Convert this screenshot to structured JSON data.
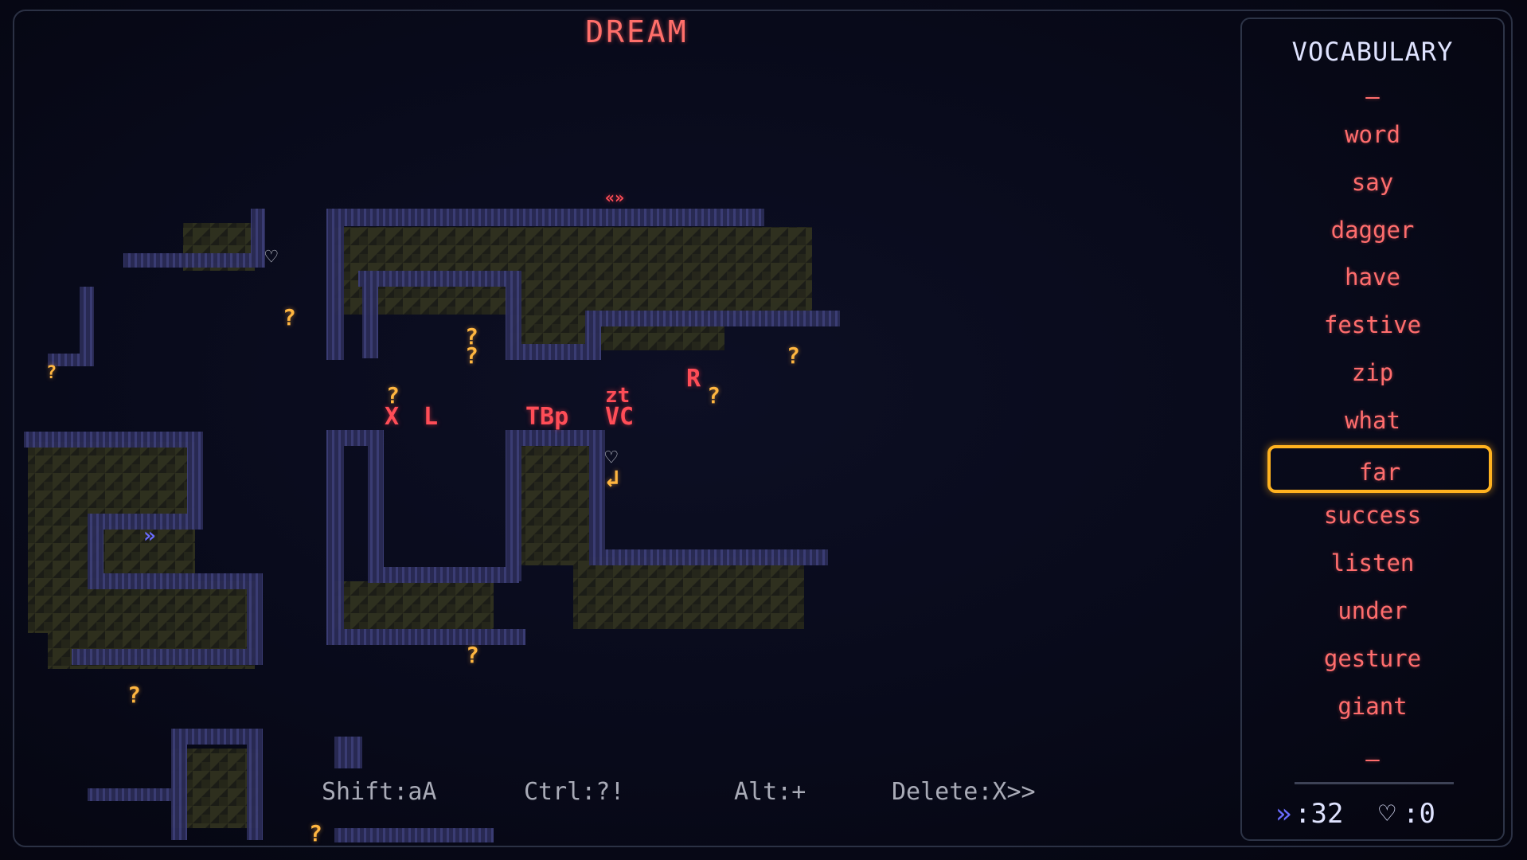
{
  "title": "DREAM",
  "vocabulary": {
    "title": "VOCABULARY",
    "top_marker": "–",
    "words": [
      "word",
      "say",
      "dagger",
      "have",
      "festive",
      "zip",
      "what",
      "far",
      "success",
      "listen",
      "under",
      "gesture",
      "giant"
    ],
    "selected": "far",
    "bottom_marker": "–",
    "arrows_icon": "»",
    "arrows_count": ":32",
    "heart_icon": "♡",
    "hearts_count": ":0"
  },
  "controls": {
    "shift": "Shift:aA",
    "ctrl": "Ctrl:?!",
    "alt": "Alt:+",
    "delete": "Delete:X>>"
  },
  "map_glyphs": {
    "question": "?",
    "letter_x": "X",
    "letter_l": "L",
    "letters_tbp": "TBp",
    "letters_zt": "zt",
    "letters_vc": "VC",
    "letter_r": "R",
    "player_double_arrow": "»",
    "return_arrow": "↲",
    "heart": "♡",
    "top_marker": "«»"
  },
  "colors": {
    "accent": "#ffb21f",
    "word": "#ff6d6d",
    "question": "#ffb640",
    "wall": "#3c3f6e",
    "floor": "#3a3a22"
  }
}
